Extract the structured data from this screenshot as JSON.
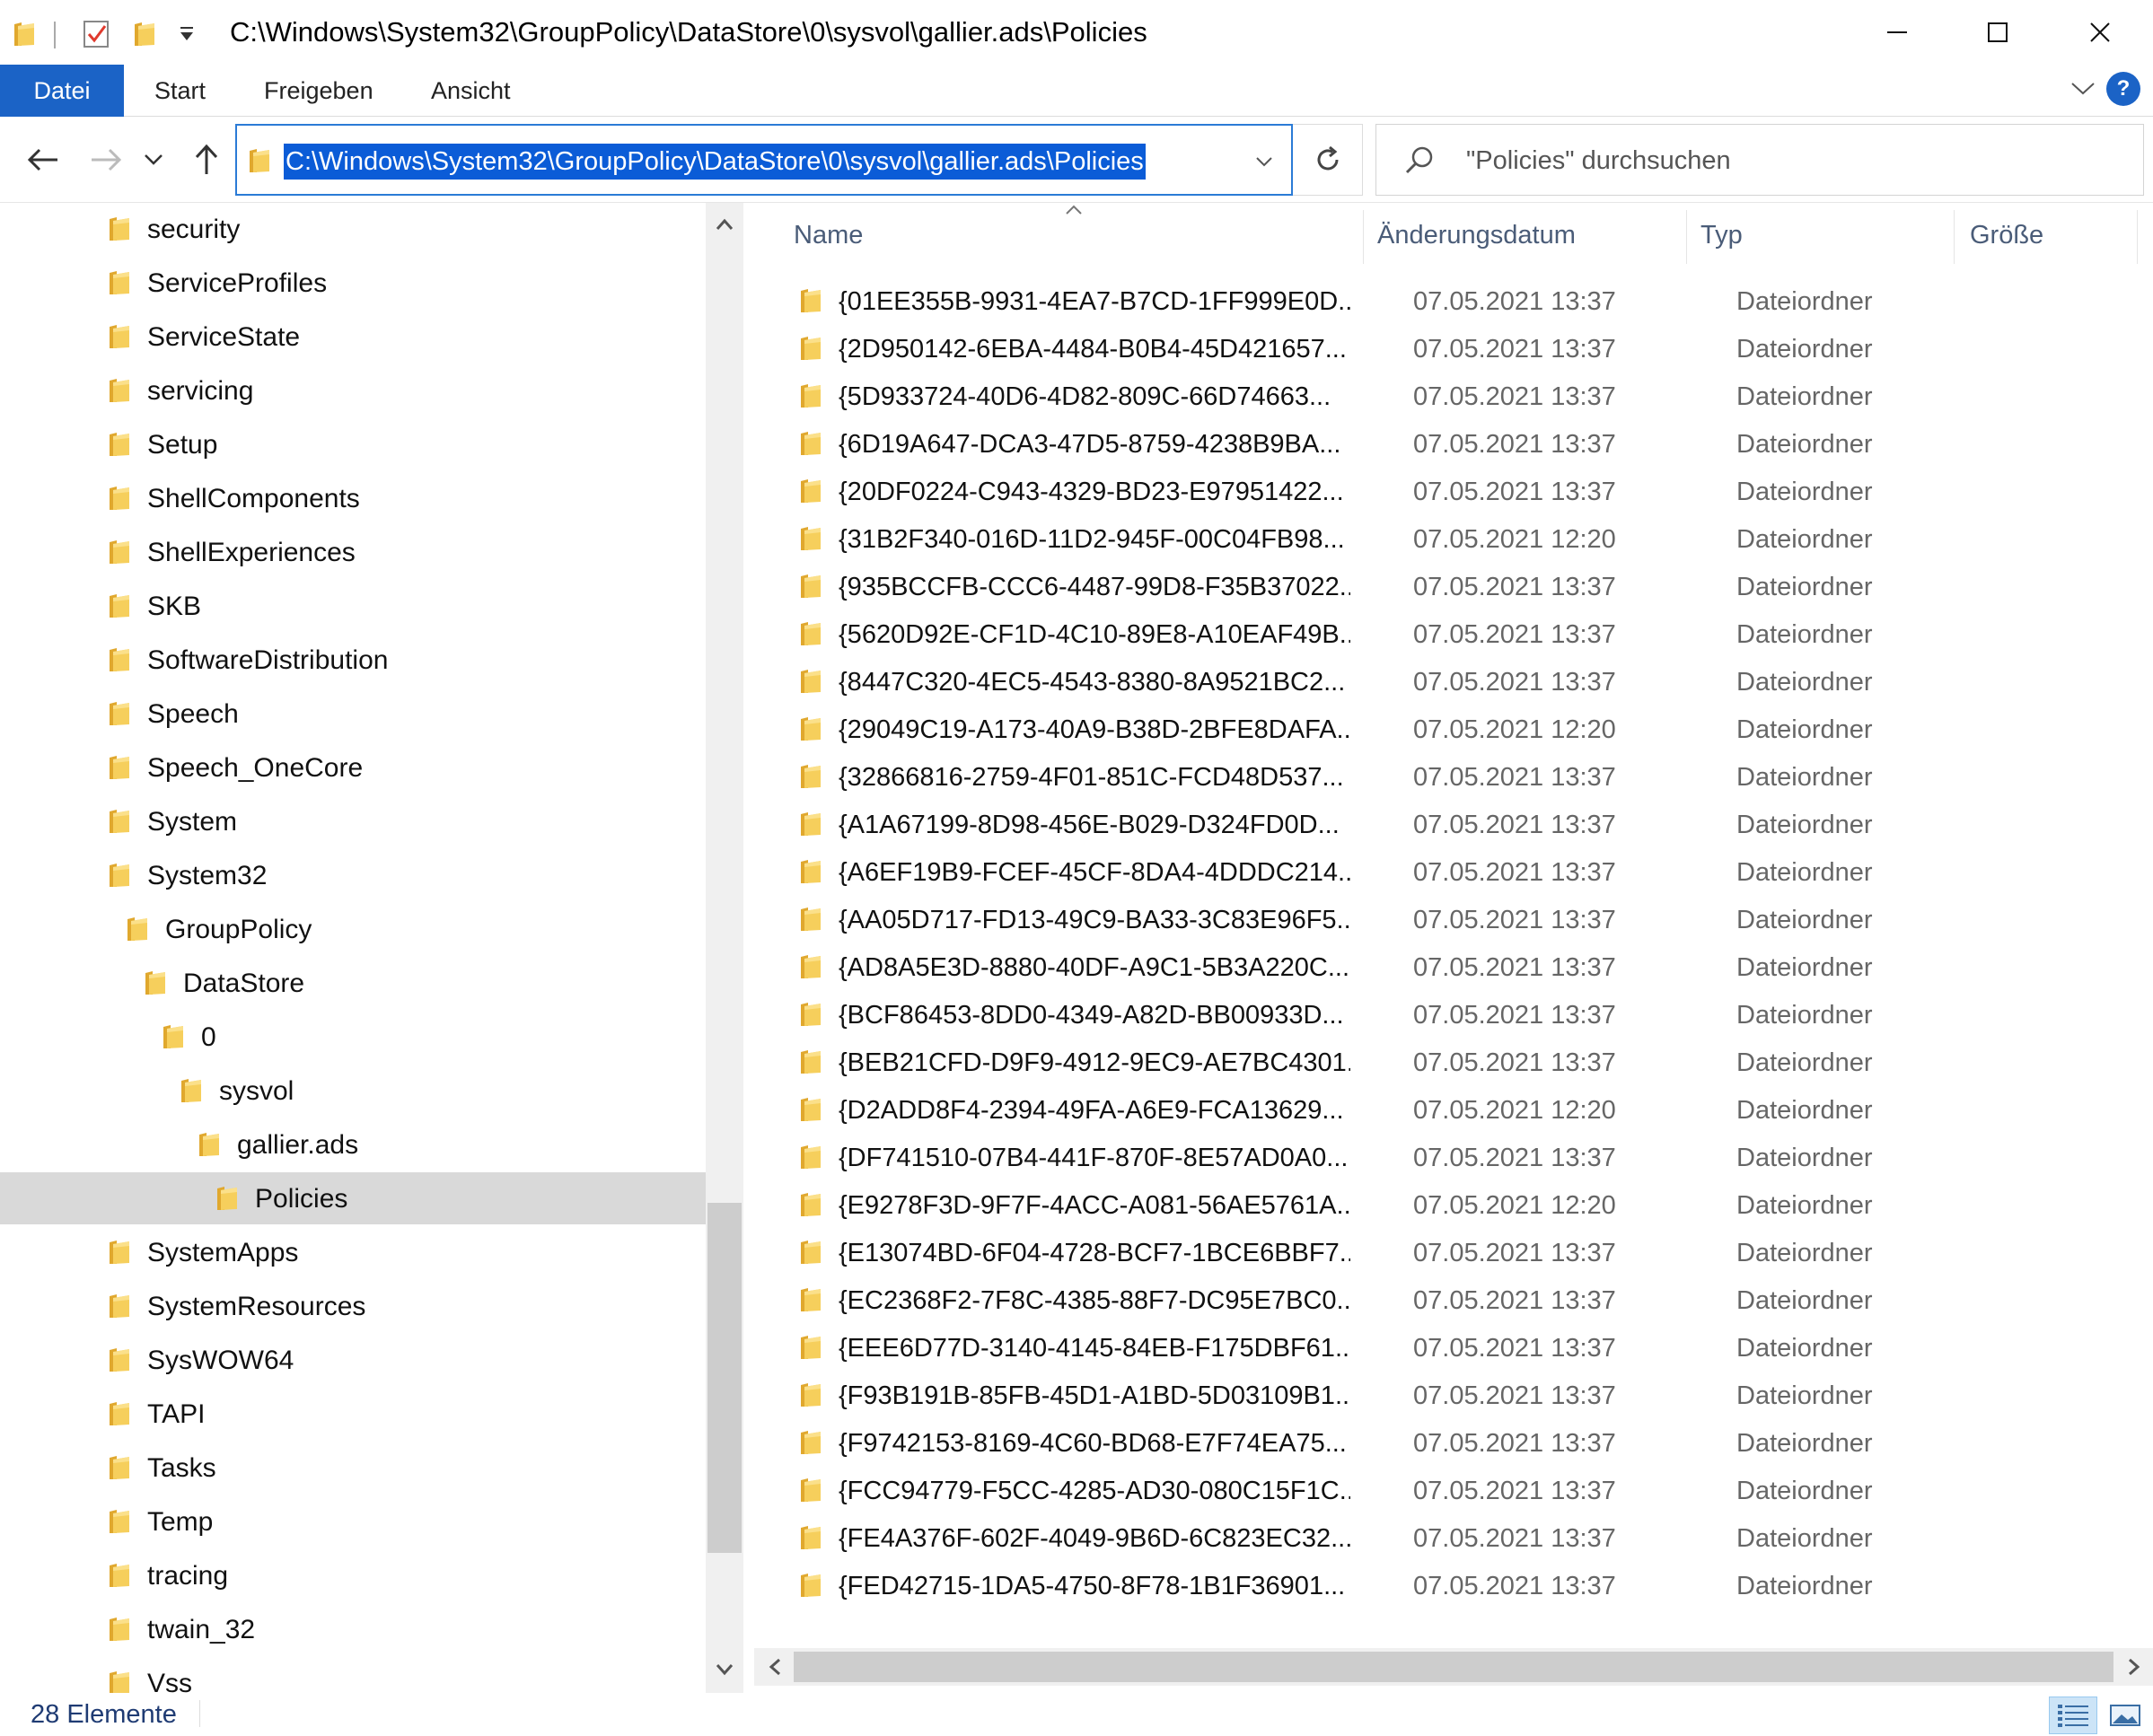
{
  "window": {
    "title": "C:\\Windows\\System32\\GroupPolicy\\DataStore\\0\\sysvol\\gallier.ads\\Policies",
    "minimize_label": "—",
    "maximize_label": "☐",
    "close_label": "✕"
  },
  "ribbon": {
    "tabs": [
      "Datei",
      "Start",
      "Freigeben",
      "Ansicht"
    ],
    "help_label": "?"
  },
  "address": {
    "path": "C:\\Windows\\System32\\GroupPolicy\\DataStore\\0\\sysvol\\gallier.ads\\Policies"
  },
  "search": {
    "placeholder": "\"Policies\" durchsuchen"
  },
  "nav_tree": [
    {
      "label": "security",
      "level": 0
    },
    {
      "label": "ServiceProfiles",
      "level": 0
    },
    {
      "label": "ServiceState",
      "level": 0
    },
    {
      "label": "servicing",
      "level": 0
    },
    {
      "label": "Setup",
      "level": 0
    },
    {
      "label": "ShellComponents",
      "level": 0
    },
    {
      "label": "ShellExperiences",
      "level": 0
    },
    {
      "label": "SKB",
      "level": 0
    },
    {
      "label": "SoftwareDistribution",
      "level": 0
    },
    {
      "label": "Speech",
      "level": 0
    },
    {
      "label": "Speech_OneCore",
      "level": 0
    },
    {
      "label": "System",
      "level": 0
    },
    {
      "label": "System32",
      "level": 0
    },
    {
      "label": "GroupPolicy",
      "level": 1
    },
    {
      "label": "DataStore",
      "level": 2
    },
    {
      "label": "0",
      "level": 3
    },
    {
      "label": "sysvol",
      "level": 4
    },
    {
      "label": "gallier.ads",
      "level": 5
    },
    {
      "label": "Policies",
      "level": 6,
      "selected": true
    },
    {
      "label": "SystemApps",
      "level": 0
    },
    {
      "label": "SystemResources",
      "level": 0
    },
    {
      "label": "SysWOW64",
      "level": 0
    },
    {
      "label": "TAPI",
      "level": 0
    },
    {
      "label": "Tasks",
      "level": 0
    },
    {
      "label": "Temp",
      "level": 0
    },
    {
      "label": "tracing",
      "level": 0
    },
    {
      "label": "twain_32",
      "level": 0
    },
    {
      "label": "Vss",
      "level": 0
    }
  ],
  "columns": {
    "name": "Name",
    "date": "Änderungsdatum",
    "type": "Typ",
    "size": "Größe"
  },
  "files": [
    {
      "name": "{01EE355B-9931-4EA7-B7CD-1FF999E0D...",
      "date": "07.05.2021 13:37",
      "type": "Dateiordner"
    },
    {
      "name": "{2D950142-6EBA-4484-B0B4-45D421657...",
      "date": "07.05.2021 13:37",
      "type": "Dateiordner"
    },
    {
      "name": "{5D933724-40D6-4D82-809C-66D74663...",
      "date": "07.05.2021 13:37",
      "type": "Dateiordner"
    },
    {
      "name": "{6D19A647-DCA3-47D5-8759-4238B9BA...",
      "date": "07.05.2021 13:37",
      "type": "Dateiordner"
    },
    {
      "name": "{20DF0224-C943-4329-BD23-E97951422...",
      "date": "07.05.2021 13:37",
      "type": "Dateiordner"
    },
    {
      "name": "{31B2F340-016D-11D2-945F-00C04FB98...",
      "date": "07.05.2021 12:20",
      "type": "Dateiordner"
    },
    {
      "name": "{935BCCFB-CCC6-4487-99D8-F35B37022...",
      "date": "07.05.2021 13:37",
      "type": "Dateiordner"
    },
    {
      "name": "{5620D92E-CF1D-4C10-89E8-A10EAF49B...",
      "date": "07.05.2021 13:37",
      "type": "Dateiordner"
    },
    {
      "name": "{8447C320-4EC5-4543-8380-8A9521BC2...",
      "date": "07.05.2021 13:37",
      "type": "Dateiordner"
    },
    {
      "name": "{29049C19-A173-40A9-B38D-2BFE8DAFA...",
      "date": "07.05.2021 12:20",
      "type": "Dateiordner"
    },
    {
      "name": "{32866816-2759-4F01-851C-FCD48D537...",
      "date": "07.05.2021 13:37",
      "type": "Dateiordner"
    },
    {
      "name": "{A1A67199-8D98-456E-B029-D324FD0D...",
      "date": "07.05.2021 13:37",
      "type": "Dateiordner"
    },
    {
      "name": "{A6EF19B9-FCEF-45CF-8DA4-4DDDC214...",
      "date": "07.05.2021 13:37",
      "type": "Dateiordner"
    },
    {
      "name": "{AA05D717-FD13-49C9-BA33-3C83E96F5...",
      "date": "07.05.2021 13:37",
      "type": "Dateiordner"
    },
    {
      "name": "{AD8A5E3D-8880-40DF-A9C1-5B3A220C...",
      "date": "07.05.2021 13:37",
      "type": "Dateiordner"
    },
    {
      "name": "{BCF86453-8DD0-4349-A82D-BB00933D...",
      "date": "07.05.2021 13:37",
      "type": "Dateiordner"
    },
    {
      "name": "{BEB21CFD-D9F9-4912-9EC9-AE7BC4301...",
      "date": "07.05.2021 13:37",
      "type": "Dateiordner"
    },
    {
      "name": "{D2ADD8F4-2394-49FA-A6E9-FCA13629...",
      "date": "07.05.2021 12:20",
      "type": "Dateiordner"
    },
    {
      "name": "{DF741510-07B4-441F-870F-8E57AD0A0...",
      "date": "07.05.2021 13:37",
      "type": "Dateiordner"
    },
    {
      "name": "{E9278F3D-9F7F-4ACC-A081-56AE5761A...",
      "date": "07.05.2021 12:20",
      "type": "Dateiordner"
    },
    {
      "name": "{E13074BD-6F04-4728-BCF7-1BCE6BBF7...",
      "date": "07.05.2021 13:37",
      "type": "Dateiordner"
    },
    {
      "name": "{EC2368F2-7F8C-4385-88F7-DC95E7BC0...",
      "date": "07.05.2021 13:37",
      "type": "Dateiordner"
    },
    {
      "name": "{EEE6D77D-3140-4145-84EB-F175DBF61...",
      "date": "07.05.2021 13:37",
      "type": "Dateiordner"
    },
    {
      "name": "{F93B191B-85FB-45D1-A1BD-5D03109B1...",
      "date": "07.05.2021 13:37",
      "type": "Dateiordner"
    },
    {
      "name": "{F9742153-8169-4C60-BD68-E7F74EA75...",
      "date": "07.05.2021 13:37",
      "type": "Dateiordner"
    },
    {
      "name": "{FCC94779-F5CC-4285-AD30-080C15F1C...",
      "date": "07.05.2021 13:37",
      "type": "Dateiordner"
    },
    {
      "name": "{FE4A376F-602F-4049-9B6D-6C823EC32...",
      "date": "07.05.2021 13:37",
      "type": "Dateiordner"
    },
    {
      "name": "{FED42715-1DA5-4750-8F78-1B1F36901...",
      "date": "07.05.2021 13:37",
      "type": "Dateiordner"
    }
  ],
  "status": {
    "count_text": "28 Elemente"
  },
  "colors": {
    "accent": "#1b63c6",
    "folder": "#f5c955",
    "selection": "#d9d9d9"
  }
}
